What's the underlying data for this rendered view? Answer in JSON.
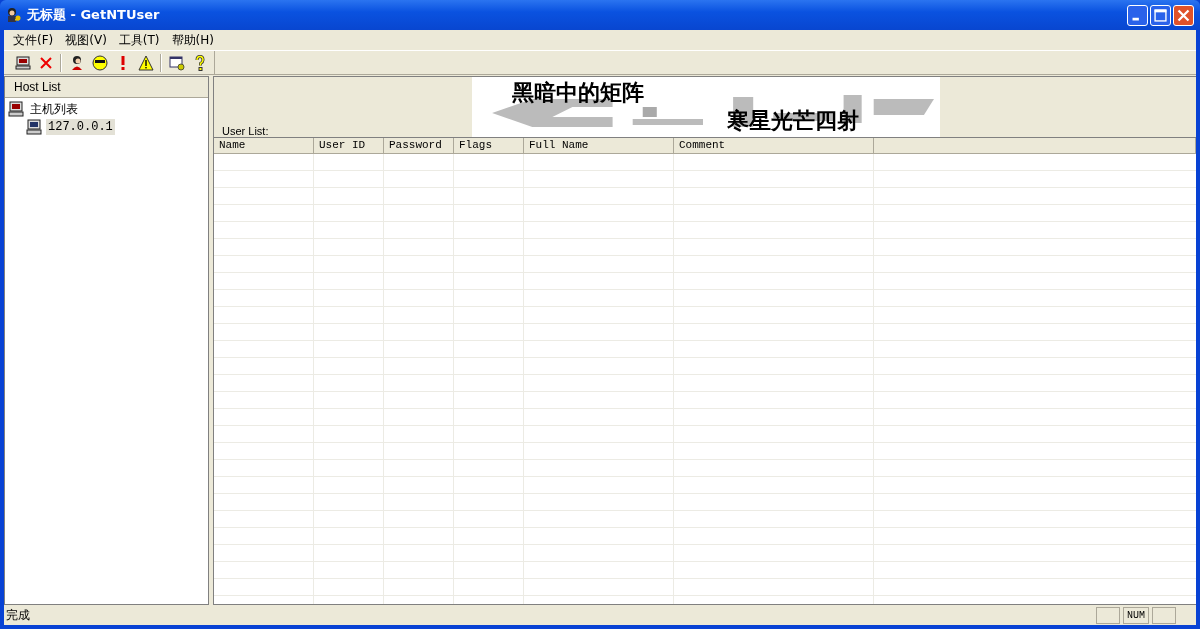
{
  "window": {
    "title": "无标题 - GetNTUser"
  },
  "menu": [
    "文件(F)",
    "视图(V)",
    "工具(T)",
    "帮助(H)"
  ],
  "host_panel": {
    "header": "Host List",
    "tree": [
      {
        "label": "主机列表",
        "expanded": true,
        "selected": false,
        "children": [
          {
            "label": "127.0.0.1",
            "selected": true
          }
        ]
      }
    ]
  },
  "banner": {
    "line_1": "黑暗中的矩阵",
    "line_2": "寒星光芒四射"
  },
  "user_list": {
    "label": "User List:",
    "columns": [
      "Name",
      "User ID",
      "Password",
      "Flags",
      "Full Name",
      "Comment"
    ]
  },
  "status_bar": {
    "text": "完成",
    "num_indicator": "NUM"
  }
}
